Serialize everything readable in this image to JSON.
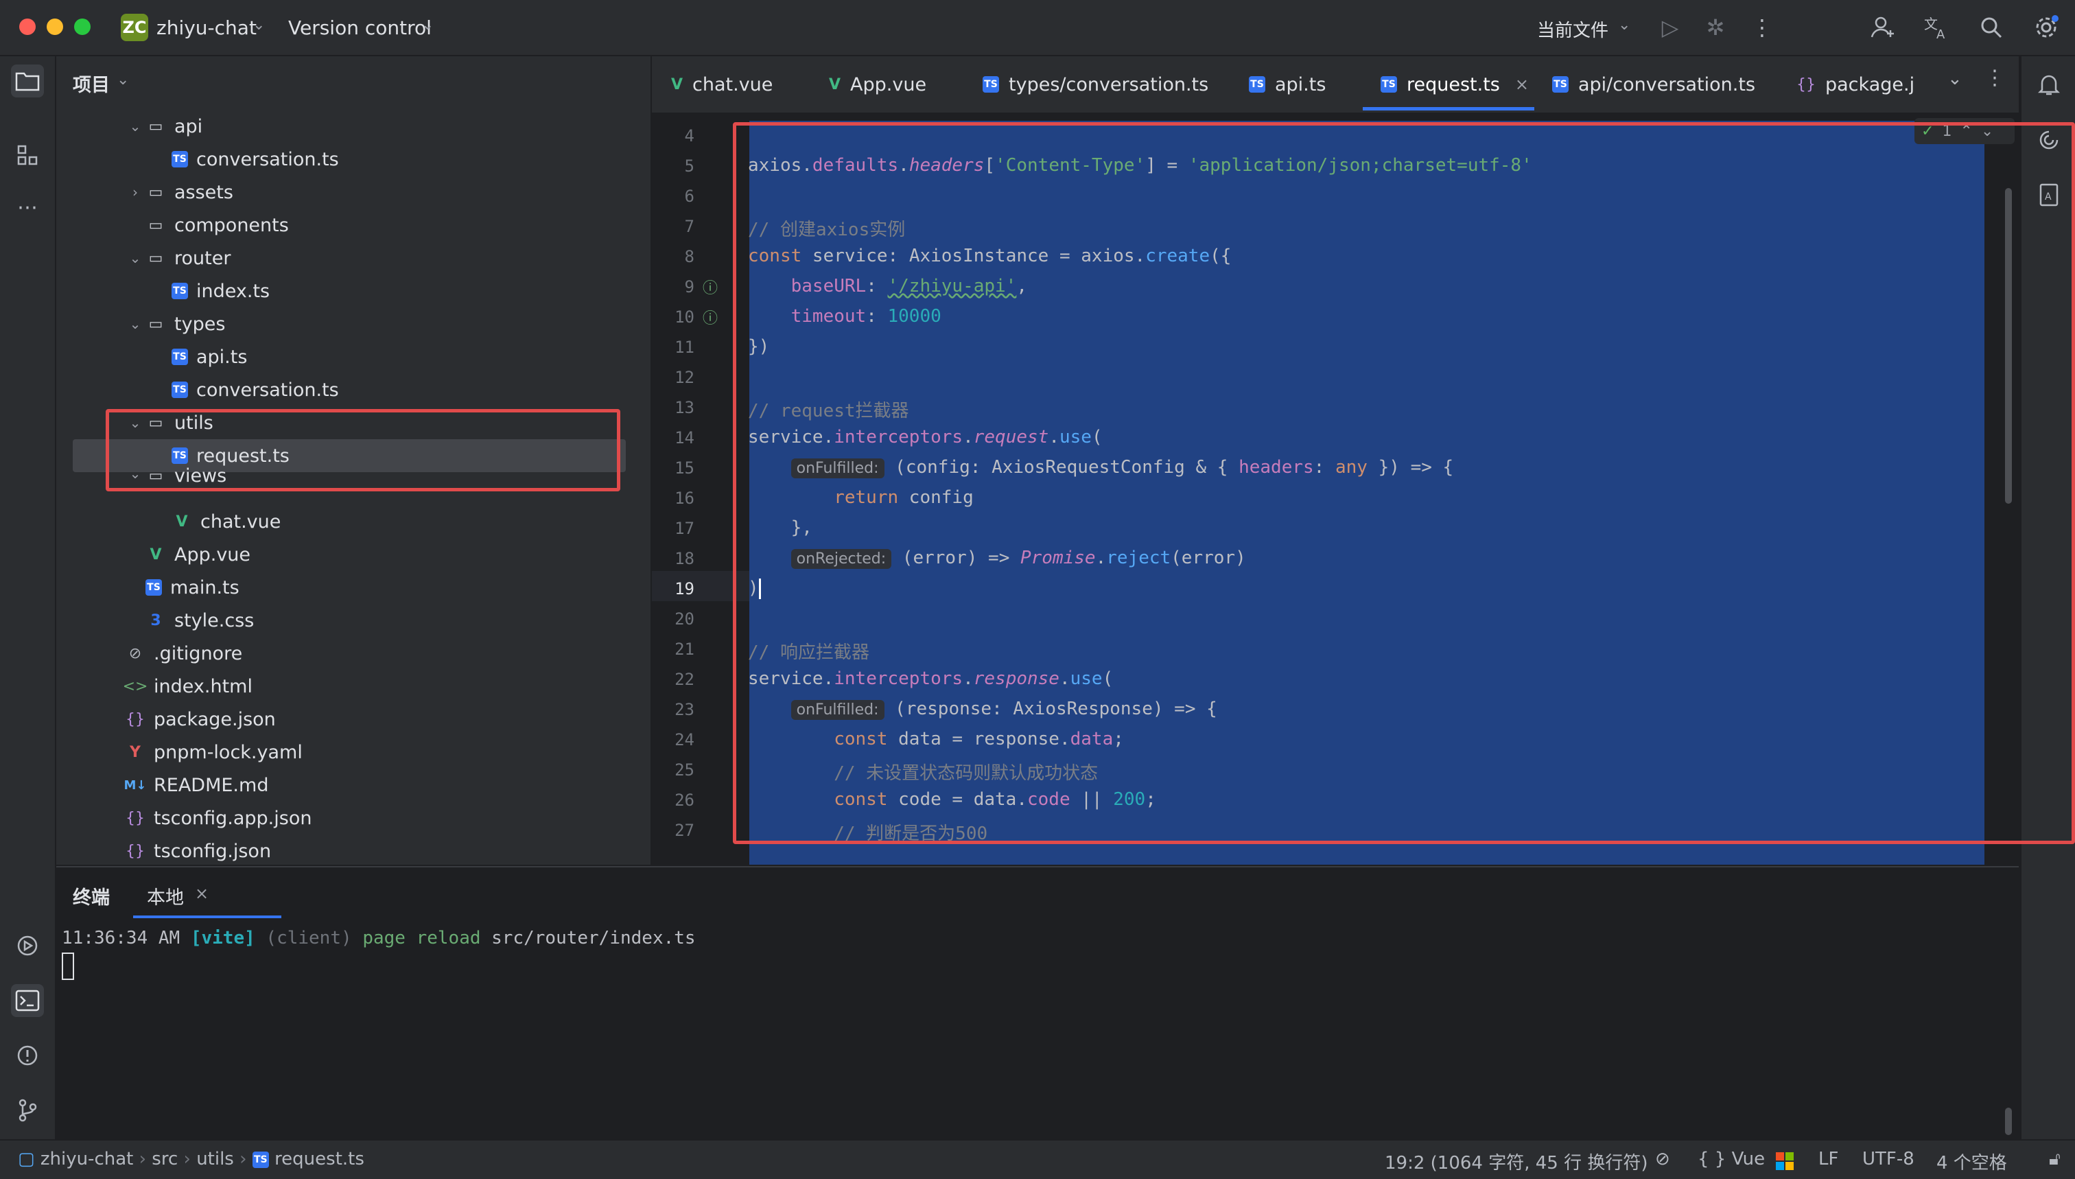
{
  "window": {
    "project_badge": "ZC",
    "project_name": "zhiyu-chat",
    "version_control": "Version control",
    "run_config": "当前文件"
  },
  "project_panel": {
    "title": "项目",
    "items": [
      {
        "label": "api",
        "type": "folder",
        "expanded": true
      },
      {
        "label": "conversation.ts",
        "type": "ts"
      },
      {
        "label": "assets",
        "type": "folder",
        "expanded": false
      },
      {
        "label": "components",
        "type": "folder"
      },
      {
        "label": "router",
        "type": "folder",
        "expanded": true
      },
      {
        "label": "index.ts",
        "type": "ts"
      },
      {
        "label": "types",
        "type": "folder",
        "expanded": true
      },
      {
        "label": "api.ts",
        "type": "ts"
      },
      {
        "label": "conversation.ts",
        "type": "ts"
      },
      {
        "label": "utils",
        "type": "folder",
        "expanded": true
      },
      {
        "label": "request.ts",
        "type": "ts",
        "selected": true
      },
      {
        "label": "views",
        "type": "folder",
        "expanded": true
      },
      {
        "label": "chat.vue",
        "type": "vue"
      },
      {
        "label": "App.vue",
        "type": "vue"
      },
      {
        "label": "main.ts",
        "type": "ts"
      },
      {
        "label": "style.css",
        "type": "css"
      },
      {
        "label": ".gitignore",
        "type": "ignore"
      },
      {
        "label": "index.html",
        "type": "html"
      },
      {
        "label": "package.json",
        "type": "json"
      },
      {
        "label": "pnpm-lock.yaml",
        "type": "yaml"
      },
      {
        "label": "README.md",
        "type": "md"
      },
      {
        "label": "tsconfig.app.json",
        "type": "json"
      },
      {
        "label": "tsconfig.json",
        "type": "json"
      }
    ]
  },
  "tabs": [
    {
      "label": "chat.vue",
      "icon": "V"
    },
    {
      "label": "App.vue",
      "icon": "V"
    },
    {
      "label": "types/conversation.ts",
      "icon": "TS"
    },
    {
      "label": "api.ts",
      "icon": "TS"
    },
    {
      "label": "request.ts",
      "icon": "TS",
      "active": true
    },
    {
      "label": "api/conversation.ts",
      "icon": "TS"
    },
    {
      "label": "package.jsor",
      "icon": "{}"
    }
  ],
  "editor": {
    "line_numbers": [
      "4",
      "5",
      "6",
      "7",
      "8",
      "9",
      "10",
      "11",
      "12",
      "13",
      "14",
      "15",
      "16",
      "17",
      "18",
      "19",
      "20",
      "21",
      "22",
      "23",
      "24",
      "25",
      "26",
      "27"
    ],
    "current_line": "19",
    "inspection_count": "1",
    "code": {
      "l5_a": "axios.",
      "l5_b": "defaults",
      "l5_c": ".",
      "l5_d": "headers",
      "l5_e": "[",
      "l5_f": "'Content-Type'",
      "l5_g": "] = ",
      "l5_h": "'application/json;charset=utf-8'",
      "l7": "// 创建axios实例",
      "l8_a": "const",
      "l8_b": " service: AxiosInstance = axios.",
      "l8_c": "create",
      "l8_d": "({",
      "l9_a": "    baseURL",
      "l9_b": ": ",
      "l9_c": "'/zhiyu-api'",
      "l9_d": ",",
      "l10_a": "    timeout",
      "l10_b": ": ",
      "l10_c": "10000",
      "l11": "})",
      "l13": "// request拦截器",
      "l14_a": "service.",
      "l14_b": "interceptors",
      "l14_c": ".",
      "l14_d": "request",
      "l14_e": ".",
      "l14_f": "use",
      "l14_g": "(",
      "hint_fulfilled": "onFulfilled:",
      "l15_a": " (config: AxiosRequestConfig & { ",
      "l15_b": "headers",
      "l15_c": ": ",
      "l15_d": "any",
      "l15_e": " }) => {",
      "l16_a": "        return",
      "l16_b": " config",
      "l17": "    },",
      "hint_rejected": "onRejected:",
      "l18_a": " (error) => ",
      "l18_b": "Promise",
      "l18_c": ".",
      "l18_d": "reject",
      "l18_e": "(error)",
      "l19": ")",
      "l21": "// 响应拦截器",
      "l22_a": "service.",
      "l22_b": "interceptors",
      "l22_c": ".",
      "l22_d": "response",
      "l22_e": ".",
      "l22_f": "use",
      "l22_g": "(",
      "l23_a": " (response: AxiosResponse) => {",
      "l24_a": "        const",
      "l24_b": " data = response.",
      "l24_c": "data",
      "l24_d": ";",
      "l25": "        // 未设置状态码则默认成功状态",
      "l26_a": "        const",
      "l26_b": " code = data.",
      "l26_c": "code",
      "l26_d": " || ",
      "l26_e": "200",
      "l26_f": ";",
      "l27": "        // 判断是否为500"
    }
  },
  "terminal": {
    "title": "终端",
    "tab_local": "本地",
    "line_time": "11:36:34 AM ",
    "line_vite": "[vite]",
    "line_client": " (client) ",
    "line_reload": "page reload",
    "line_path": " src/router/index.ts"
  },
  "statusbar": {
    "breadcrumb": [
      "zhiyu-chat",
      "src",
      "utils",
      "request.ts"
    ],
    "position": "19:2 (1064 字符, 45 行 换行符)",
    "language": "Vue",
    "line_sep": "LF",
    "encoding": "UTF-8",
    "indent": "4 个空格"
  }
}
